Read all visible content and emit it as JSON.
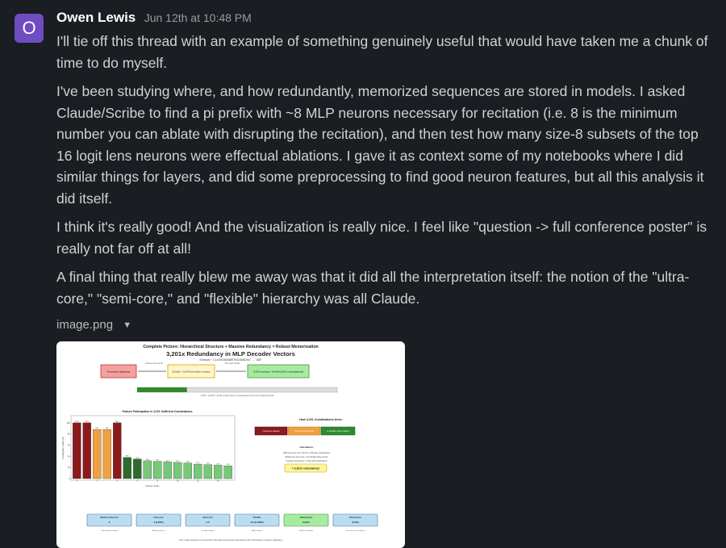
{
  "message": {
    "avatar_letter": "O",
    "author": "Owen Lewis",
    "timestamp": "Jun 12th at 10:48 PM",
    "paragraphs": [
      "I'll tie off this thread with an example of something genuinely useful that would have taken me a chunk of time to do myself.",
      "I've been studying where, and how redundantly, memorized sequences are stored in models. I asked Claude/Scribe to find a pi prefix with ~8 MLP neurons necessary for recitation (i.e. 8 is the minimum number you can ablate with disrupting the recitation), and then test how many size-8 subsets of the top 16 logit lens neurons were effectual ablations. I gave it as context some of my notebooks where I did similar things for layers, and did some preprocessing to find good neuron features, but all this analysis it did itself.",
      "I think it's really good! And the visualization is really nice. I feel like \"question -> full conference poster\" is really not far off at all!",
      "A final thing that really blew me away was that it did all the interpretation itself: the notion of the \"ultra-core,\" \"semi-core,\" and \"flexible\" hierarchy was all Claude."
    ]
  },
  "attachment": {
    "filename": "image.png",
    "poster": {
      "title_line1": "Complete Picture: Hierarchical Structure + Massive Redundancy = Robust Memorization",
      "title_line2": "3,201x Redundancy in MLP Decoder Vectors",
      "subtitle": "Example: \"3.14159265358979323846264\" → \"338\"",
      "flow_boxes": [
        "8 neurons minimum",
        "C(16,8) = 12,870 possible combos",
        "3,201 working = 24.9% (3,201x redundancy!)"
      ],
      "flow_arrows": [
        "Choose from top 16",
        "Test each combo"
      ],
      "progress_caption": "3,201 / 12,870 = 24.9% of all 8-neuron combinations from top 16 features work",
      "chart_title": "Feature Participation in 3,201 Sufficient Combinations",
      "y_label": "Participation Rate (%)",
      "x_label": "Feature Index",
      "right_title": "How 3,201 Combinations Arise:",
      "right_boxes": [
        "3 ultra-core features",
        "2-3 semi-core features",
        "1-3 flexible (many options)"
      ],
      "calc_title": "Calculation:",
      "calc_lines": [
        "With both semi-core: C(11,3) = 165 base combinations",
        "Without one semi-core, more flexible slots needed",
        "Complex interactions = 3,201 total combinations"
      ],
      "result_badge": "= 3,201x redundancy!",
      "stats": [
        {
          "label": "Minimum Neurons",
          "value": "8",
          "note": "Sub-features needed"
        },
        {
          "label": "Ultra-core",
          "value": "3 (100%)",
          "note": "Always present"
        },
        {
          "label": "Semi-core",
          "value": "2-3",
          "note": "Usually needed"
        },
        {
          "label": "Flexible",
          "value": "11 (21-38%)",
          "note": "Many options"
        },
        {
          "label": "Redundancy",
          "value": "3,201x",
          "note": "Different solutions"
        },
        {
          "label": "Robustness",
          "value": "24.9%",
          "note": "Success rate of random"
        }
      ],
      "footer": "The model achieves memorization through hierarchical redundancy with thousands of backup pathways"
    }
  },
  "chart_data": {
    "type": "bar",
    "title": "Feature Participation in 3,201 Sufficient Combinations",
    "xlabel": "Feature Index",
    "ylabel": "Participation Rate (%)",
    "ylim": [
      0,
      110
    ],
    "categories": [
      "0",
      "1",
      "2",
      "3",
      "4",
      "5",
      "6",
      "7",
      "8",
      "9",
      "10",
      "11",
      "12",
      "13",
      "14",
      "15"
    ],
    "values": [
      100,
      100,
      88,
      88,
      100,
      38,
      35,
      32,
      31,
      30,
      29,
      28,
      26,
      25,
      24,
      23
    ],
    "value_labels": [
      "100%",
      "100%",
      "88%",
      "88%",
      "100%",
      "38%",
      "35%",
      "32%",
      "31%",
      "30%",
      "29%",
      "28%",
      "26%",
      "25%",
      "24%",
      "23%"
    ],
    "x_ticks": [
      "0",
      "2",
      "4",
      "6",
      "8",
      "10",
      "12",
      "14"
    ],
    "y_ticks": [
      "0",
      "20",
      "40",
      "60",
      "80",
      "100"
    ],
    "bar_colors": [
      "#8b1a1a",
      "#8b1a1a",
      "#f0a040",
      "#f0a040",
      "#8b1a1a",
      "#2e6b2e",
      "#2e6b2e",
      "#78c878",
      "#78c878",
      "#78c878",
      "#78c878",
      "#78c878",
      "#78c878",
      "#78c878",
      "#78c878",
      "#78c878"
    ]
  },
  "colors": {
    "background": "#1a1d21",
    "avatar": "#6f4cc0",
    "text": "#d1d2d3",
    "author": "#ffffff",
    "timestamp": "#9a9b9e"
  }
}
